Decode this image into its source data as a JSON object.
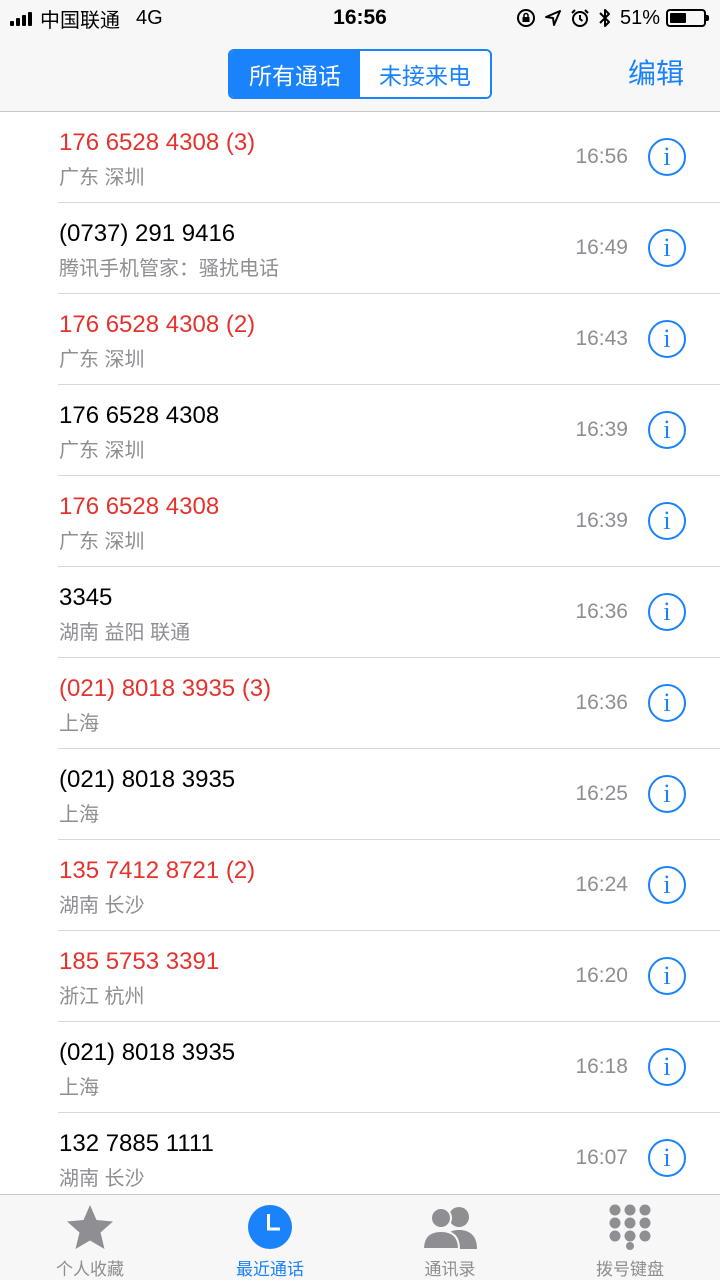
{
  "status_bar": {
    "carrier": "中国联通",
    "network": "4G",
    "time": "16:56",
    "battery": "51%",
    "battery_level": 0.51,
    "icons": [
      "signal-icon",
      "rotation-lock-icon",
      "location-icon",
      "alarm-icon",
      "bluetooth-icon",
      "battery-icon"
    ]
  },
  "nav": {
    "segments": [
      "所有通话",
      "未接来电"
    ],
    "active_segment": 0,
    "edit_label": "编辑"
  },
  "calls": [
    {
      "number": "176 6528 4308 (3)",
      "location": "广东 深圳",
      "time": "16:56",
      "missed": true
    },
    {
      "number": "(0737) 291 9416",
      "location": "腾讯手机管家：骚扰电话",
      "time": "16:49",
      "missed": false
    },
    {
      "number": "176 6528 4308 (2)",
      "location": "广东 深圳",
      "time": "16:43",
      "missed": true
    },
    {
      "number": "176 6528 4308",
      "location": "广东 深圳",
      "time": "16:39",
      "missed": false
    },
    {
      "number": "176 6528 4308",
      "location": "广东 深圳",
      "time": "16:39",
      "missed": true
    },
    {
      "number": "3345",
      "location": "湖南 益阳 联通",
      "time": "16:36",
      "missed": false
    },
    {
      "number": "(021) 8018 3935 (3)",
      "location": "上海",
      "time": "16:36",
      "missed": true
    },
    {
      "number": "(021) 8018 3935",
      "location": "上海",
      "time": "16:25",
      "missed": false
    },
    {
      "number": "135 7412 8721 (2)",
      "location": "湖南 长沙",
      "time": "16:24",
      "missed": true
    },
    {
      "number": "185 5753 3391",
      "location": "浙江 杭州",
      "time": "16:20",
      "missed": true
    },
    {
      "number": "(021) 8018 3935",
      "location": "上海",
      "time": "16:18",
      "missed": false
    },
    {
      "number": "132 7885 1111",
      "location": "湖南 长沙",
      "time": "16:07",
      "missed": false
    }
  ],
  "info_icon": "i",
  "tabs": [
    {
      "label": "个人收藏",
      "icon": "star-icon",
      "active": false
    },
    {
      "label": "最近通话",
      "icon": "clock-icon",
      "active": true
    },
    {
      "label": "通讯录",
      "icon": "contacts-icon",
      "active": false
    },
    {
      "label": "拨号键盘",
      "icon": "keypad-icon",
      "active": false
    }
  ],
  "colors": {
    "accent": "#1a82fb",
    "missed": "#e5322d",
    "secondary_text": "#8e8e93",
    "inactive_tab": "#8e8e93"
  }
}
